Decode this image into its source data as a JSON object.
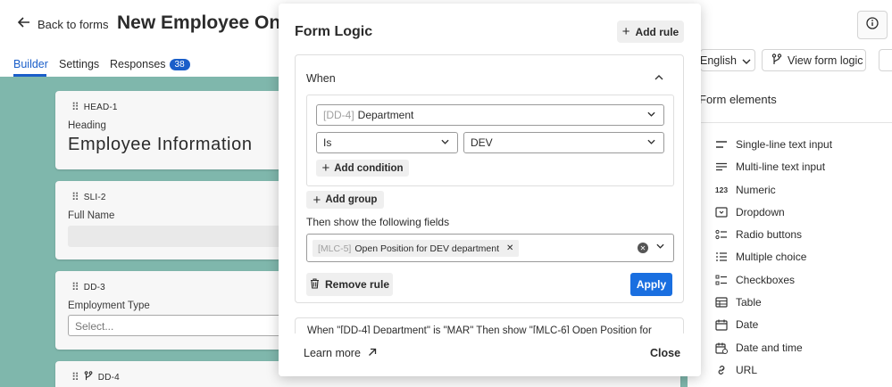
{
  "app": {
    "back_label": "Back to forms",
    "title": "New Employee Onboa",
    "tabs": [
      {
        "label": "Builder"
      },
      {
        "label": "Settings"
      },
      {
        "label": "Responses",
        "badge": "38"
      }
    ],
    "language": "English",
    "view_logic_label": "View form logic"
  },
  "form_cards": [
    {
      "tag": "HEAD-1",
      "label": "Heading",
      "heading": "Employee Information"
    },
    {
      "tag": "SLI-2",
      "label": "Full Name"
    },
    {
      "tag": "DD-3",
      "label": "Employment Type",
      "placeholder": "Select..."
    },
    {
      "tag": "DD-4"
    }
  ],
  "elements_panel": {
    "title": "Form elements",
    "items": [
      {
        "label": "Single-line text input",
        "icon": "single-line-icon"
      },
      {
        "label": "Multi-line text input",
        "icon": "multi-line-icon"
      },
      {
        "label": "Numeric",
        "icon": "numeric-icon"
      },
      {
        "label": "Dropdown",
        "icon": "dropdown-icon"
      },
      {
        "label": "Radio buttons",
        "icon": "radio-list-icon"
      },
      {
        "label": "Multiple choice",
        "icon": "multi-choice-icon"
      },
      {
        "label": "Checkboxes",
        "icon": "checkbox-list-icon"
      },
      {
        "label": "Table",
        "icon": "table-icon"
      },
      {
        "label": "Date",
        "icon": "calendar-icon"
      },
      {
        "label": "Date and time",
        "icon": "calendar-clock-icon"
      },
      {
        "label": "URL",
        "icon": "link-icon"
      }
    ]
  },
  "modal": {
    "title": "Form Logic",
    "add_rule_label": "Add rule",
    "rule": {
      "when_label": "When",
      "field_code": "[DD-4]",
      "field_name": "Department",
      "operator": "Is",
      "value": "DEV",
      "add_condition_label": "Add condition",
      "add_group_label": "Add group",
      "then_label": "Then show the following fields",
      "chip_code": "[MLC-5]",
      "chip_name": "Open Position for DEV department",
      "remove_rule_label": "Remove rule",
      "apply_label": "Apply"
    },
    "summary_text": "When \"[DD-4] Department\" is \"MAR\" Then show \"[MLC-6] Open Position for",
    "learn_more_label": "Learn more",
    "close_label": "Close"
  }
}
